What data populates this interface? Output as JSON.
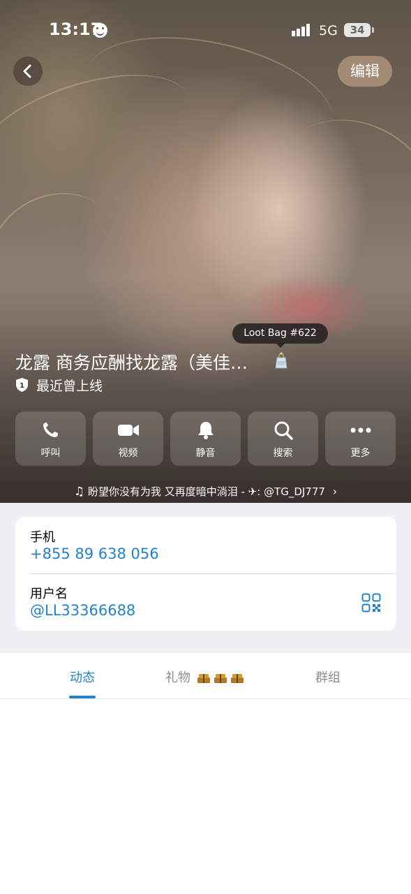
{
  "status_bar": {
    "time": "13:17",
    "network": "5G",
    "battery": "34"
  },
  "header": {
    "edit_label": "编辑",
    "loot_tooltip": "Loot Bag #622"
  },
  "profile": {
    "name": "龙露 商务应酬找龙露（美佳…",
    "status": "最近曾上线",
    "shield_number": "1"
  },
  "actions": [
    {
      "label": "呼叫",
      "icon": "phone-icon"
    },
    {
      "label": "视频",
      "icon": "video-icon"
    },
    {
      "label": "静音",
      "icon": "bell-icon"
    },
    {
      "label": "搜索",
      "icon": "search-icon"
    },
    {
      "label": "更多",
      "icon": "more-icon"
    }
  ],
  "music": {
    "text": "盼望你没有为我 又再度暗中淌泪 - ✈: @TG_DJ777"
  },
  "info": {
    "phone_label": "手机",
    "phone_value": "+855 89 638 056",
    "username_label": "用户名",
    "username_value": "@LL33366688"
  },
  "tabs": {
    "items": [
      "动态",
      "礼物",
      "群组"
    ],
    "active": "动态"
  },
  "colors": {
    "accent": "#2481cc",
    "background_grey": "#efeff4"
  }
}
